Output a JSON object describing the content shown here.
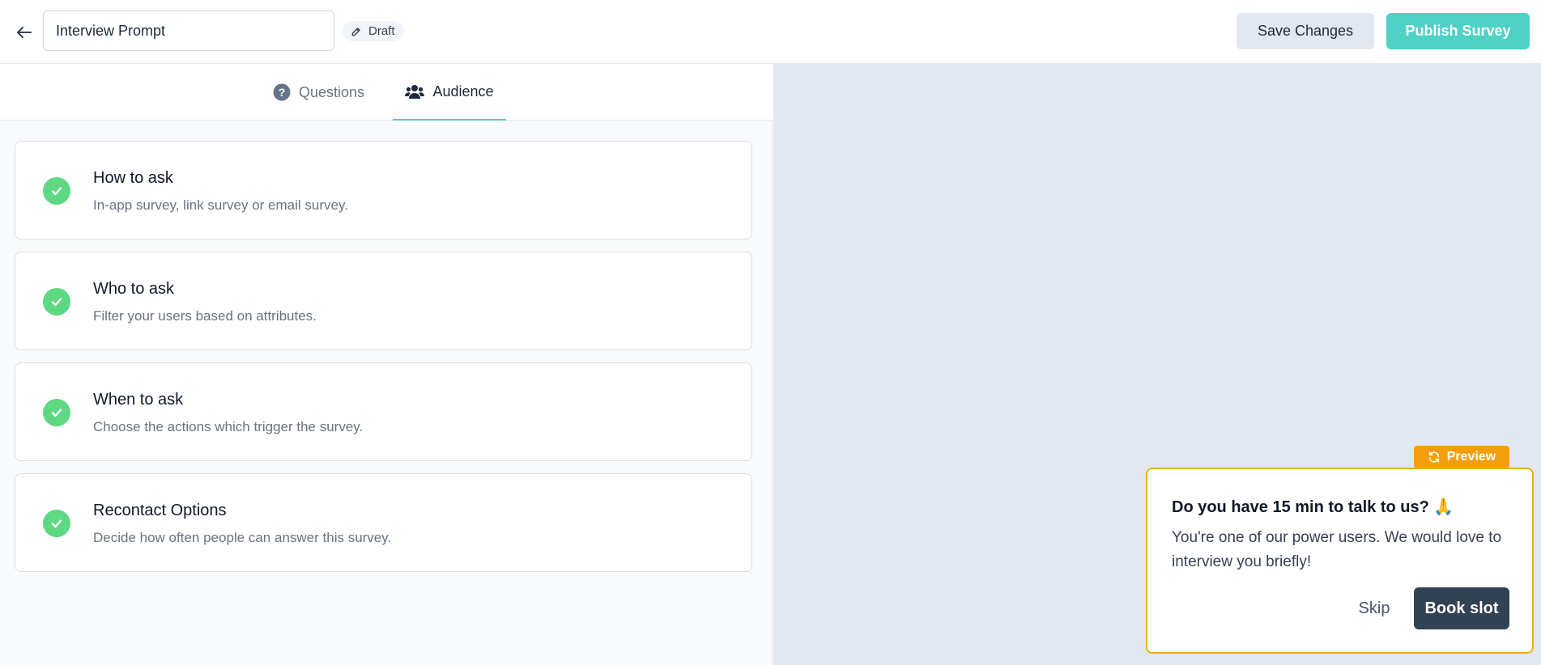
{
  "header": {
    "survey_name": "Interview Prompt",
    "status_badge": "Draft",
    "save_label": "Save Changes",
    "publish_label": "Publish Survey"
  },
  "tabs": [
    {
      "label": "Questions",
      "icon": "question-circle-icon",
      "active": false
    },
    {
      "label": "Audience",
      "icon": "users-icon",
      "active": true
    }
  ],
  "audience_cards": [
    {
      "title": "How to ask",
      "description": "In-app survey, link survey or email survey.",
      "completed": true
    },
    {
      "title": "Who to ask",
      "description": "Filter your users based on attributes.",
      "completed": true
    },
    {
      "title": "When to ask",
      "description": "Choose the actions which trigger the survey.",
      "completed": true
    },
    {
      "title": "Recontact Options",
      "description": "Decide how often people can answer this survey.",
      "completed": true
    }
  ],
  "preview": {
    "badge_label": "Preview",
    "question": "Do you have 15 min to talk to us? 🙏",
    "subheader": "You're one of our power users. We would love to interview you briefly!",
    "skip_label": "Skip",
    "submit_label": "Book slot"
  },
  "colors": {
    "brand_teal": "#4fd1c5",
    "check_green": "#5ed883",
    "preview_orange": "#f59e0b",
    "preview_border": "#eab308",
    "dark_button": "#334155"
  }
}
